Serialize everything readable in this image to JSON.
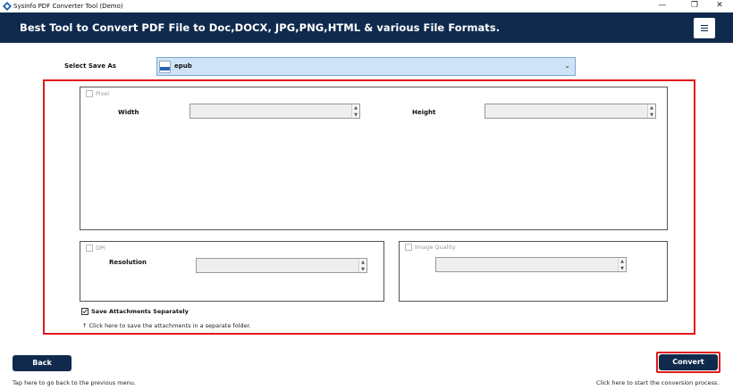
{
  "window": {
    "title": "Sysinfo PDF Converter Tool (Demo)",
    "minimize_glyph": "—",
    "restore_glyph": "❐",
    "close_glyph": "✕"
  },
  "header": {
    "title": "Best Tool to Convert PDF File to Doc,DOCX, JPG,PNG,HTML & various File Formats.",
    "menu_icon": "hamburger-menu-icon"
  },
  "save_as": {
    "label": "Select Save As",
    "value": "epub",
    "file_icon": "epub-file-icon",
    "chevron": "⌄"
  },
  "pixel_group": {
    "checkbox_label": "Pixel",
    "checked": false,
    "width_label": "Width",
    "width_value": "",
    "height_label": "Height",
    "height_value": ""
  },
  "dpi_group": {
    "checkbox_label": "DPI",
    "checked": false,
    "resolution_label": "Resolution",
    "resolution_value": ""
  },
  "quality_group": {
    "checkbox_label": "Image Quality",
    "checked": false,
    "quality_value": ""
  },
  "attachments": {
    "label": "Save Attachments Separately",
    "checked": true,
    "hint": "↑ Click here to save the attachments in a separate folder."
  },
  "footer": {
    "back_label": "Back",
    "back_hint": "Tap here to go back to the previous menu.",
    "convert_label": "Convert",
    "convert_hint": "Click here to start the conversion process."
  },
  "colors": {
    "header_bg": "#0f2a4d",
    "highlight_border": "#e11919",
    "select_bg": "#cfe3f7"
  }
}
